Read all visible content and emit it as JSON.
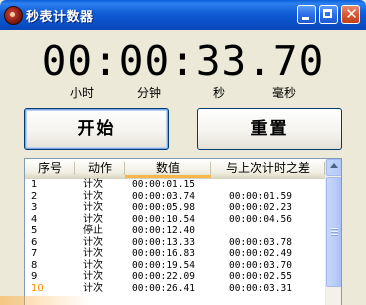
{
  "window": {
    "title": "秒表计数器",
    "buttons": {
      "minimize": "minimize",
      "maximize": "maximize",
      "close": "✕"
    }
  },
  "display": {
    "time": "00:00:33.70",
    "units": {
      "hour": "小时",
      "minute": "分钟",
      "second": "秒",
      "millisecond": "毫秒"
    }
  },
  "controls": {
    "start_label": "开始",
    "reset_label": "重置"
  },
  "list": {
    "columns": {
      "seq": "序号",
      "action": "动作",
      "value": "数值",
      "diff": "与上次计时之差"
    },
    "rows": [
      {
        "seq": "1",
        "action": "计次",
        "value": "00:00:01.15",
        "diff": ""
      },
      {
        "seq": "2",
        "action": "计次",
        "value": "00:00:03.74",
        "diff": "00:00:01.59"
      },
      {
        "seq": "3",
        "action": "计次",
        "value": "00:00:05.98",
        "diff": "00:00:02.23"
      },
      {
        "seq": "4",
        "action": "计次",
        "value": "00:00:10.54",
        "diff": "00:00:04.56"
      },
      {
        "seq": "5",
        "action": "停止",
        "value": "00:00:12.40",
        "diff": ""
      },
      {
        "seq": "6",
        "action": "计次",
        "value": "00:00:13.33",
        "diff": "00:00:03.78"
      },
      {
        "seq": "7",
        "action": "计次",
        "value": "00:00:16.83",
        "diff": "00:00:02.49"
      },
      {
        "seq": "8",
        "action": "计次",
        "value": "00:00:19.54",
        "diff": "00:00:03.70"
      },
      {
        "seq": "9",
        "action": "计次",
        "value": "00:00:22.09",
        "diff": "00:00:02.55"
      },
      {
        "seq": "10",
        "action": "计次",
        "value": "00:00:26.41",
        "diff": "00:00:03.31"
      }
    ]
  },
  "colors": {
    "title_bar": "#0a4fc6",
    "header_sort_accent": "#f7b64b",
    "last_row_number": "#ff8a00"
  },
  "icons": {
    "app": "stopwatch-icon",
    "scroll_up": "arrow-up-icon"
  }
}
